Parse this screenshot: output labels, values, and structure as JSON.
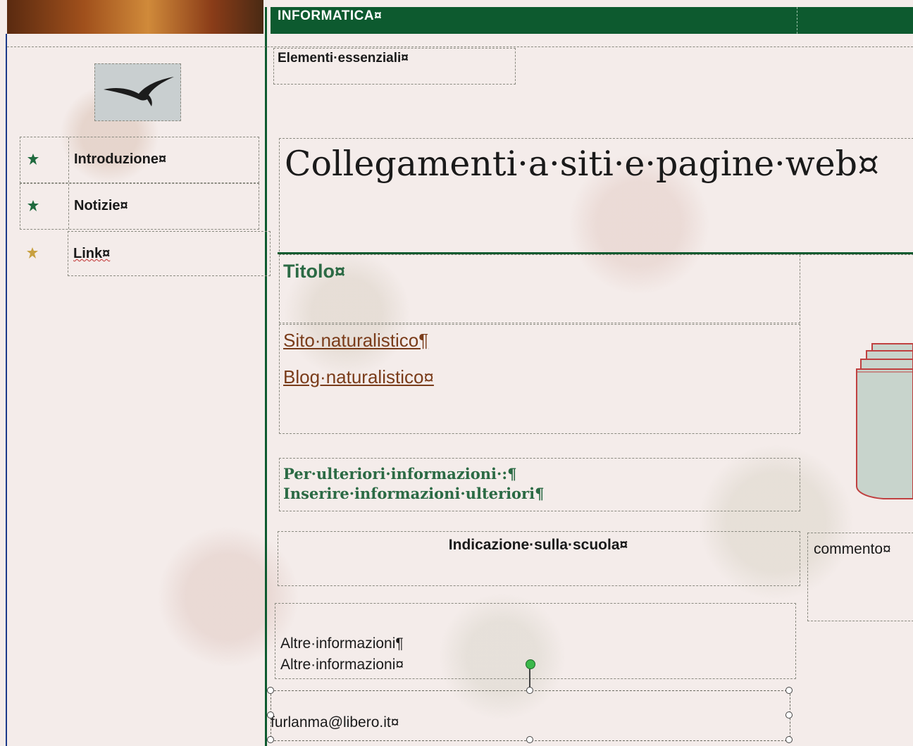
{
  "header": {
    "title": "INFORMATICA¤"
  },
  "sidebar": {
    "items": [
      {
        "label": "Introduzione¤",
        "bullet_color": "#1f6a3e"
      },
      {
        "label": "Notizie¤",
        "bullet_color": "#1f6a3e"
      },
      {
        "label": "Link¤",
        "bullet_color": "#c8a040"
      }
    ]
  },
  "main": {
    "section_label": "Elementi·essenziali¤",
    "page_title": "Collegamenti·a·siti·e·pagine·web¤",
    "titolo": "Titolo¤",
    "links": [
      "Sito·naturalistico¶",
      "Blog·naturalistico¤"
    ],
    "info": [
      "Per·ulteriori·informazioni·:¶",
      "Inserire·informazioni·ulteriori¶"
    ],
    "school": "Indicazione·sulla·scuola¤",
    "comment": "commento¤",
    "more_info": [
      "Altre·informazioni¶",
      "Altre·informazioni¤"
    ],
    "email": "furlanma@libero.it¤"
  },
  "colors": {
    "header_green": "#0d5a2f",
    "title_green": "#2b6a44",
    "link_brown": "#7a3c1a"
  }
}
